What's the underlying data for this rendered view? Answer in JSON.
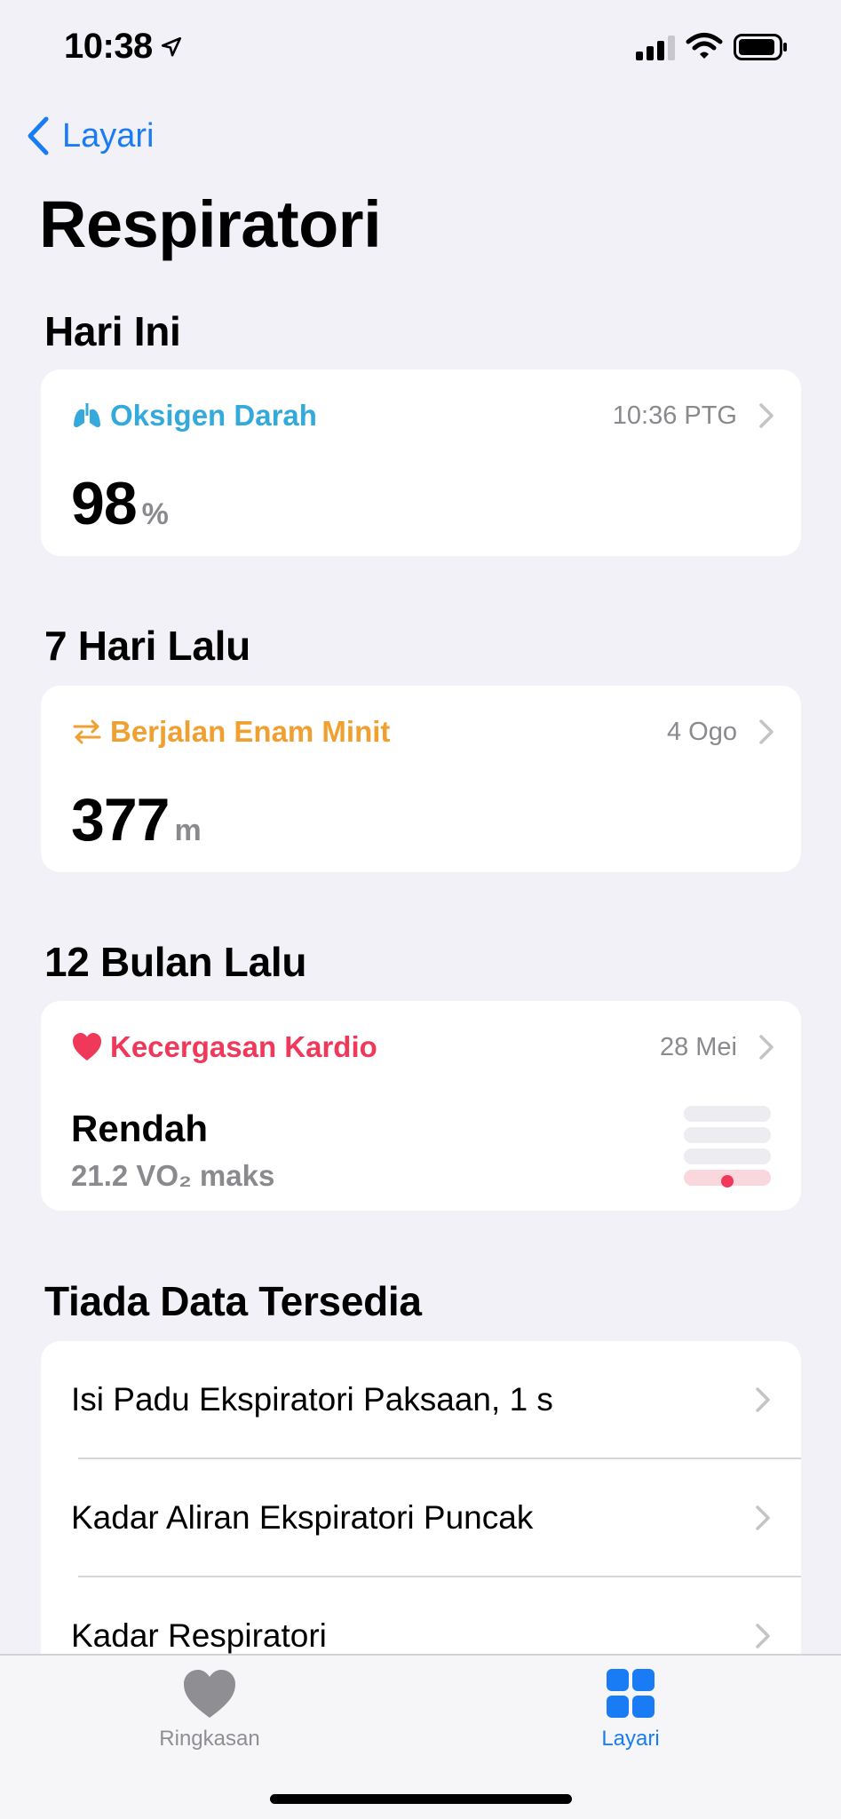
{
  "status_bar": {
    "time": "10:38"
  },
  "nav": {
    "back_label": "Layari"
  },
  "page": {
    "title": "Respiratori"
  },
  "sections": [
    {
      "header": "Hari Ini",
      "card": {
        "title": "Oksigen Darah",
        "time": "10:36 PTG",
        "value": "98",
        "unit": "%",
        "accent": "#34aadc",
        "icon": "lungs-icon"
      }
    },
    {
      "header": "7 Hari Lalu",
      "card": {
        "title": "Berjalan Enam Minit",
        "time": "4 Ogo",
        "value": "377",
        "unit": "m",
        "accent": "#f0a030",
        "icon": "arrows-icon"
      }
    },
    {
      "header": "12 Bulan Lalu",
      "card": {
        "title": "Kecergasan Kardio",
        "time": "28 Mei",
        "level": "Rendah",
        "subtitle": "21.2 VO₂ maks",
        "accent": "#f0385a",
        "icon": "heart-icon"
      }
    }
  ],
  "no_data": {
    "header": "Tiada Data Tersedia",
    "items": [
      "Isi Padu Ekspiratori Paksaan, 1 s",
      "Kadar Aliran Ekspiratori Puncak",
      "Kadar Respiratori"
    ]
  },
  "tab_bar": {
    "tabs": [
      {
        "label": "Ringkasan",
        "icon": "heart-icon",
        "active": false
      },
      {
        "label": "Layari",
        "icon": "grid-icon",
        "active": true
      }
    ],
    "active_color": "#1a7cf5",
    "inactive_color": "#8e8e93"
  }
}
